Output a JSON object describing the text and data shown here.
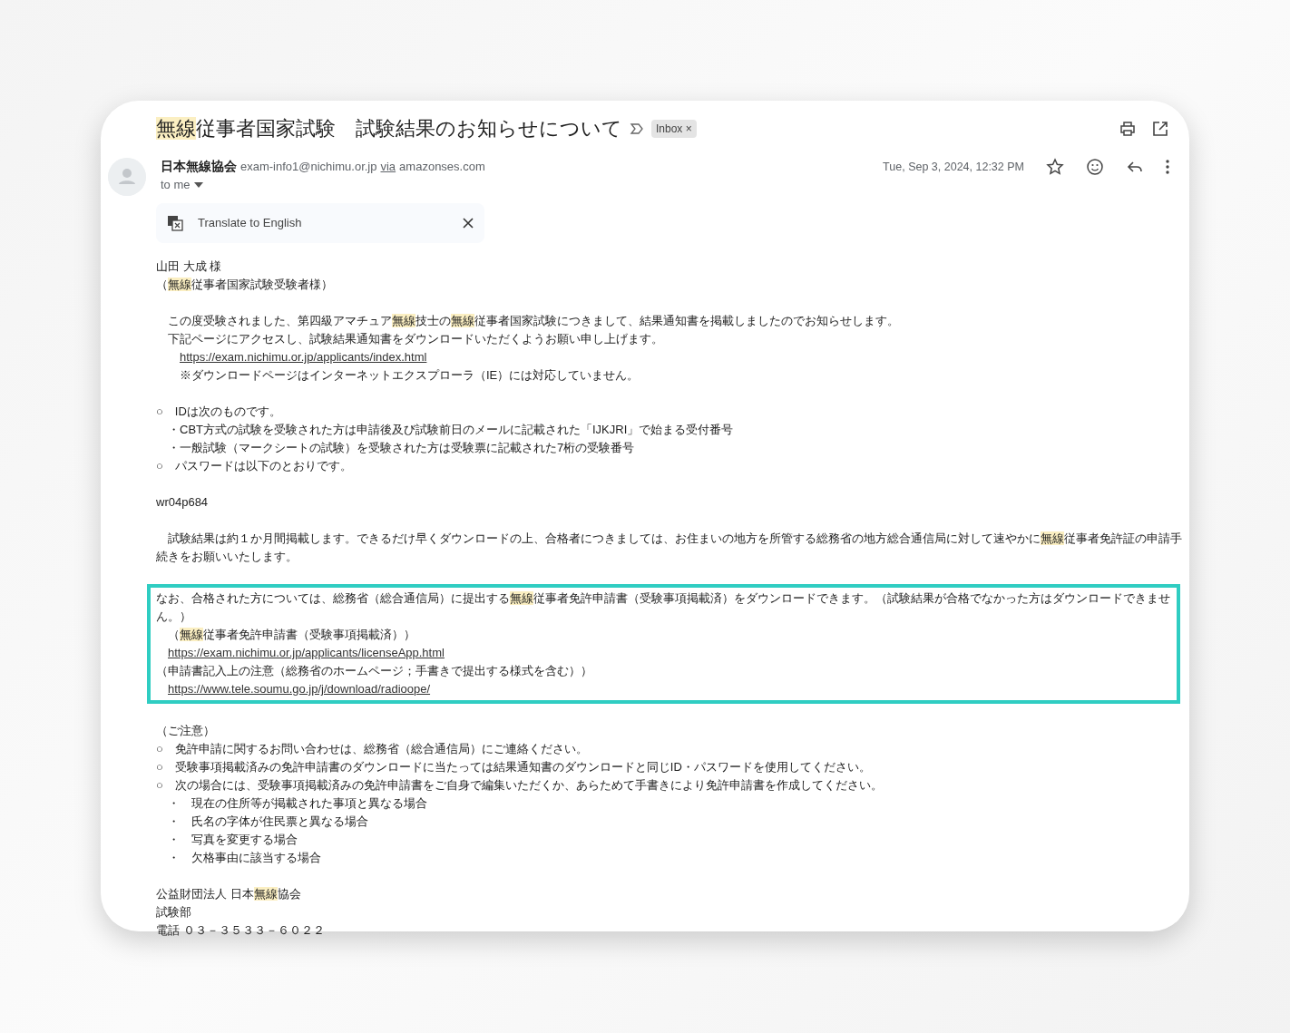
{
  "subject": {
    "segments": [
      {
        "text": "無線",
        "highlighted": true
      },
      {
        "text": "従事者国家試験　試験結果のお知らせについて",
        "highlighted": false
      }
    ]
  },
  "label": {
    "text": "Inbox",
    "close": "×"
  },
  "sender": {
    "name": "日本無線協会",
    "email": "exam-info1@nichimu.or.jp",
    "via": "via",
    "domain": "amazonses.com",
    "to": "to me"
  },
  "date": "Tue, Sep 3, 2024, 12:32 PM",
  "translate": {
    "text": "Translate to English"
  },
  "blocks": [
    {
      "outlined": false,
      "lines": [
        {
          "kind": "text",
          "segments": [
            {
              "text": "山田 大成 様",
              "highlighted": false
            }
          ]
        },
        {
          "kind": "text",
          "segments": [
            {
              "text": "（",
              "highlighted": false
            },
            {
              "text": "無線",
              "highlighted": true
            },
            {
              "text": "従事者国家試験受験者様）",
              "highlighted": false
            }
          ]
        }
      ]
    },
    {
      "outlined": false,
      "lines": [
        {
          "kind": "text",
          "segments": [
            {
              "text": "　この度受験されました、第四級アマチュア",
              "highlighted": false
            },
            {
              "text": "無線",
              "highlighted": true
            },
            {
              "text": "技士の",
              "highlighted": false
            },
            {
              "text": "無線",
              "highlighted": true
            },
            {
              "text": "従事者国家試験につきまして、結果通知書を掲載しましたのでお知らせします。",
              "highlighted": false
            }
          ]
        },
        {
          "kind": "text",
          "segments": [
            {
              "text": "　下記ページにアクセスし、試験結果通知書をダウンロードいただくようお願い申し上げます。",
              "highlighted": false
            }
          ]
        },
        {
          "kind": "deep-link",
          "text": "https://exam.nichimu.or.jp/applicants/index.html"
        },
        {
          "kind": "text",
          "segments": [
            {
              "text": "　　※ダウンロードページはインターネットエクスプローラ（IE）には対応していません。",
              "highlighted": false
            }
          ]
        }
      ]
    },
    {
      "outlined": false,
      "lines": [
        {
          "kind": "text",
          "segments": [
            {
              "text": "○　IDは次のものです。",
              "highlighted": false
            }
          ]
        },
        {
          "kind": "text",
          "segments": [
            {
              "text": "　・CBT方式の試験を受験された方は申請後及び試験前日のメールに記載された「IJKJRI」で始まる受付番号",
              "highlighted": false
            }
          ]
        },
        {
          "kind": "text",
          "segments": [
            {
              "text": "　・一般試験（マークシートの試験）を受験された方は受験票に記載された7桁の受験番号",
              "highlighted": false
            }
          ]
        },
        {
          "kind": "text",
          "segments": [
            {
              "text": "○　パスワードは以下のとおりです。",
              "highlighted": false
            }
          ]
        }
      ]
    },
    {
      "outlined": false,
      "lines": [
        {
          "kind": "text",
          "segments": [
            {
              "text": "wr04p684",
              "highlighted": false
            }
          ]
        }
      ]
    },
    {
      "outlined": false,
      "lines": [
        {
          "kind": "text",
          "segments": [
            {
              "text": "　試験結果は約１か月間掲載します。できるだけ早くダウンロードの上、合格者につきましては、お住まいの地方を所管する総務省の地方総合通信局に対して速やかに",
              "highlighted": false
            },
            {
              "text": "無線",
              "highlighted": true
            },
            {
              "text": "従事者免許証の申請手続きをお願いいたします。",
              "highlighted": false
            }
          ]
        }
      ]
    },
    {
      "outlined": true,
      "lines": [
        {
          "kind": "text",
          "segments": [
            {
              "text": "なお、合格された方については、総務省（総合通信局）に提出する",
              "highlighted": false
            },
            {
              "text": "無線",
              "highlighted": true
            },
            {
              "text": "従事者免許申請書（受験事項掲載済）をダウンロードできます。（試験結果が合格でなかった方はダウンロードできません。）",
              "highlighted": false
            }
          ]
        },
        {
          "kind": "text",
          "segments": [
            {
              "text": "　（",
              "highlighted": false
            },
            {
              "text": "無線",
              "highlighted": true
            },
            {
              "text": "従事者免許申請書（受験事項掲載済））",
              "highlighted": false
            }
          ]
        },
        {
          "kind": "link",
          "text": "https://exam.nichimu.or.jp/applicants/licenseApp.html"
        },
        {
          "kind": "text",
          "segments": [
            {
              "text": "（申請書記入上の注意（総務省のホームページ；手書きで提出する様式を含む））",
              "highlighted": false
            }
          ]
        },
        {
          "kind": "link",
          "text": "https://www.tele.soumu.go.jp/j/download/radioope/"
        }
      ]
    },
    {
      "outlined": false,
      "lines": [
        {
          "kind": "text",
          "segments": [
            {
              "text": "（ご注意）",
              "highlighted": false
            }
          ]
        },
        {
          "kind": "text",
          "segments": [
            {
              "text": "○　免許申請に関するお問い合わせは、総務省（総合通信局）にご連絡ください。",
              "highlighted": false
            }
          ]
        },
        {
          "kind": "text",
          "segments": [
            {
              "text": "○　受験事項掲載済みの免許申請書のダウンロードに当たっては結果通知書のダウンロードと同じID・パスワードを使用してください。",
              "highlighted": false
            }
          ]
        },
        {
          "kind": "text",
          "segments": [
            {
              "text": "○　次の場合には、受験事項掲載済みの免許申請書をご自身で編集いただくか、あらためて手書きにより免許申請書を作成してください。",
              "highlighted": false
            }
          ]
        },
        {
          "kind": "text",
          "segments": [
            {
              "text": "　・　現在の住所等が掲載された事項と異なる場合",
              "highlighted": false
            }
          ]
        },
        {
          "kind": "text",
          "segments": [
            {
              "text": "　・　氏名の字体が住民票と異なる場合",
              "highlighted": false
            }
          ]
        },
        {
          "kind": "text",
          "segments": [
            {
              "text": "　・　写真を変更する場合",
              "highlighted": false
            }
          ]
        },
        {
          "kind": "text",
          "segments": [
            {
              "text": "　・　欠格事由に該当する場合",
              "highlighted": false
            }
          ]
        }
      ]
    },
    {
      "outlined": false,
      "lines": [
        {
          "kind": "text",
          "segments": [
            {
              "text": "公益財団法人 日本",
              "highlighted": false
            },
            {
              "text": "無線",
              "highlighted": true
            },
            {
              "text": "協会",
              "highlighted": false
            }
          ]
        },
        {
          "kind": "text",
          "segments": [
            {
              "text": "試験部",
              "highlighted": false
            }
          ]
        },
        {
          "kind": "text",
          "segments": [
            {
              "text": "電話 ０３－３５３３－６０２２",
              "highlighted": false
            }
          ]
        }
      ]
    }
  ]
}
